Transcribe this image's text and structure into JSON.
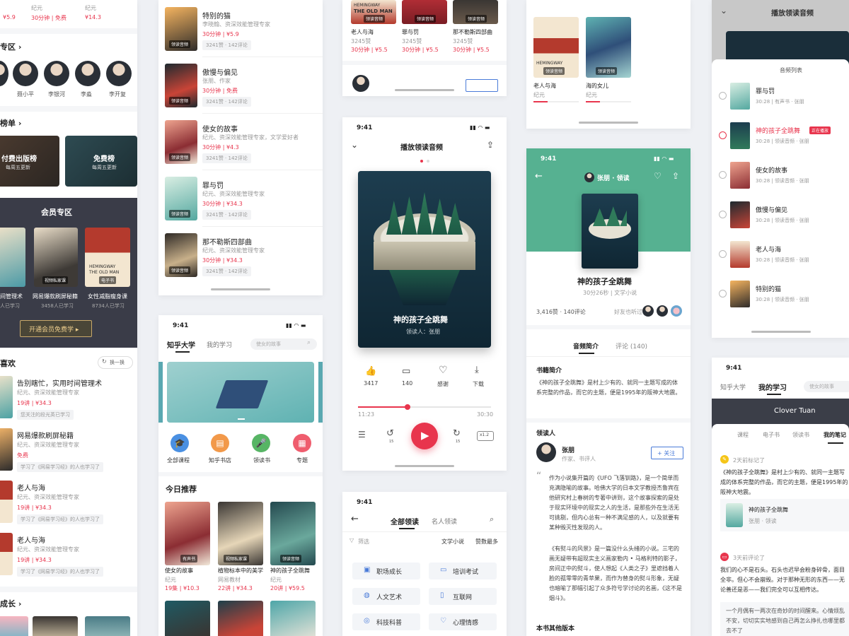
{
  "col1": {
    "top_prices": [
      "¥5.9",
      "30分钟 | 免费",
      "¥14.3"
    ],
    "top_labels": [
      "纪元",
      "30分钟 | 免费",
      "纪元"
    ],
    "expert_title": "专区",
    "experts": [
      "聂小平",
      "李银河",
      "李淼",
      "李开复"
    ],
    "rank_title": "榜单",
    "rank_cards": [
      {
        "title": "付费出版榜",
        "sub": "每周五更新"
      },
      {
        "title": "免费榜",
        "sub": "每周五更新"
      }
    ],
    "member_title": "会员专区",
    "member_books": [
      {
        "title": "间管理术",
        "count": "人已学习"
      },
      {
        "title": "网易爆款刷屏秘籍",
        "count": "3458人已学习",
        "badge": "视频私家课"
      },
      {
        "title": "女性减脂瘦身课",
        "count": "8734人已学习",
        "badge": "电子书"
      }
    ],
    "member_button": "开通会员免费学 ▸",
    "like_title": "喜欢",
    "refresh": "换一换",
    "likes": [
      {
        "title": "告别瞎忙，实用时间管理术",
        "sub": "纪元、资深效能管理专家",
        "price": "19讲 | ¥34.3",
        "tag": "您关注的段光英已学习"
      },
      {
        "title": "网易爆款刷屏秘籍",
        "sub": "纪元、资深效能管理专家",
        "price": "免费",
        "tag": "学习了《网易学习经》的人也学习了"
      },
      {
        "title": "老人与海",
        "sub": "纪元、资深效能管理专家",
        "price": "19讲 | ¥34.3",
        "tag": "学习了《网易学习经》的人也学习了"
      },
      {
        "title": "老人与海",
        "sub": "纪元、资深效能管理专家",
        "price": "19讲 | ¥34.3",
        "tag": "学习了《网易学习经》的人也学习了"
      }
    ],
    "grow_title": "成长"
  },
  "col2": {
    "list": [
      {
        "title": "特别的猫",
        "sub": "李晓翰、资深效能管理专家",
        "price": "30分钟 | ¥5.9",
        "tag": "3241赞 · 142评论",
        "badge": "领读音频"
      },
      {
        "title": "傲慢与偏见",
        "sub": "张朋、作家",
        "price": "30分钟 | 免费",
        "tag": "3241赞 · 142评论",
        "badge": "领读音频"
      },
      {
        "title": "使女的故事",
        "sub": "纪元、资深效能管理专家，文学爱好者",
        "price": "30分钟 | ¥4.3",
        "tag": "3241赞 · 142评论",
        "badge": "领读音频"
      },
      {
        "title": "罪与罚",
        "sub": "纪元、资深效能管理专家",
        "price": "30分钟 | ¥34.3",
        "tag": "3241赞 · 142评论",
        "badge": "领读音频"
      },
      {
        "title": "那不勒斯四部曲",
        "sub": "纪元、资深效能管理专家",
        "price": "30分钟 | ¥34.3",
        "tag": "3241赞 · 142评论",
        "badge": "领读音频"
      }
    ],
    "home": {
      "time": "9:41",
      "tab_active": "知乎大学",
      "tab_other": "我的学习",
      "search_placeholder": "使女的故事",
      "shortcuts": [
        "全部课程",
        "知乎书店",
        "领读书",
        "专题"
      ],
      "recommend_title": "今日推荐",
      "recs": [
        {
          "title": "使女的故事",
          "sub": "纪元",
          "price": "19集 | ¥10.3",
          "badge": "有声书"
        },
        {
          "title": "植物标本中的美学",
          "sub": "网易教材",
          "price": "22讲 | ¥34.3",
          "badge": "视频私家课"
        },
        {
          "title": "神的孩子全跳舞",
          "sub": "纪元",
          "price": "20讲 | ¥59.5",
          "badge": "领读音频"
        }
      ]
    }
  },
  "col3": {
    "top_books": [
      {
        "title": "老人与海",
        "sub": "3245赞",
        "price": "30分钟 | ¥5.5",
        "badge": "领读音频"
      },
      {
        "title": "罪与罚",
        "sub": "3245赞",
        "price": "30分钟 | ¥5.5",
        "badge": "领读音频"
      },
      {
        "title": "那不勒斯四部曲",
        "sub": "3245赞",
        "price": "30分钟 | ¥5.5",
        "badge": "领读音频"
      }
    ],
    "player": {
      "time": "9:41",
      "title": "播放领读音频",
      "book_title": "神的孩子全跳舞",
      "reader": "领读人：张朋",
      "actions": [
        {
          "count": "3417"
        },
        {
          "count": "140"
        },
        {
          "count": "感谢"
        },
        {
          "count": "下载"
        }
      ],
      "time_current": "11:23",
      "time_total": "30:30",
      "speed": "x1.2",
      "skip": "15"
    },
    "category": {
      "time": "9:41",
      "tab_active": "全部领读",
      "tab_other": "名人领读",
      "filter": "筛选",
      "sort_a": "文学小说",
      "sort_b": "赞数最多",
      "chips": [
        "职场成长",
        "培训考试",
        "人文艺术",
        "互联网",
        "科技科普",
        "心理情感"
      ]
    }
  },
  "col4": {
    "top_books": [
      {
        "title": "老人与海",
        "sub": "纪元",
        "badge": "领读音频"
      },
      {
        "title": "海的女儿",
        "sub": "纪元",
        "badge": "领读音频"
      }
    ],
    "detail": {
      "time": "9:41",
      "reader_header": "张朋 · 领读",
      "book_title": "神的孩子全跳舞",
      "meta": "30分26秒 | 文学小说",
      "stats": "3,416赞 · 140评论",
      "friends": "好友也听过",
      "tab_active": "音频简介",
      "tab_other": "评论 (140)",
      "intro_title": "书籍简介",
      "intro_text": "《神的孩子全跳舞》是村上少有的、就同一主题写成的体系完整的作品，而它的主题，便是1995年的阪神大地震。",
      "reader_title": "领读人",
      "reader_name": "张朋",
      "reader_role": "作家、书评人",
      "follow": "+ 关注",
      "quote_1": "作为小说集开篇的《UFO 飞落钏路》，是一个简单而充满隐喻的故事。哈佛大学的日本文学教授杰鲁宾在他研究村上春树的专著中讲到，这个故事探索的是处于现实环境中的现实之人的生活，是那些外在生活无可挑剔，但内心总有一种不满足感的人，以及就要有某种毁灭性发现的人。",
      "quote_2": "《有熨斗的风景》是一篇没什么头绪的小说。三宅的画无疑带有超现实主义画家勒内 • 马格利特的影子，房间正中的熨斗，使人想起《人类之子》里遮挡着人脸的孤零零的青苹果，而作为替身的熨斗形象，无疑也暗喻了那幅引起了众多符号学讨论的名画，《这不是烟斗》。",
      "more_title": "本书其他版本"
    }
  },
  "col5": {
    "header_title": "播放领读音频",
    "playlist_title": "音频列表",
    "playing_badge": "正在播放",
    "items": [
      {
        "title": "罪与罚",
        "sub": "30:28 | 有声书 · 张朋"
      },
      {
        "title": "神的孩子全跳舞",
        "sub": "30:28 | 领读音频 · 张朋"
      },
      {
        "title": "使女的故事",
        "sub": "30:28 | 领读音频 · 张朋"
      },
      {
        "title": "傲慢与偏见",
        "sub": "30:28 | 领读音频 · 张朋"
      },
      {
        "title": "老人与海",
        "sub": "30:28 | 领读音频 · 张朋"
      },
      {
        "title": "特别的猫",
        "sub": "30:28 | 领读音频 · 张朋"
      }
    ],
    "notes": {
      "time": "9:41",
      "tab_other": "知乎大学",
      "tab_active": "我的学习",
      "search_placeholder": "使女的故事",
      "user": "Clover Tuan",
      "subtabs": [
        "课程",
        "电子书",
        "领读书",
        "我的笔记"
      ],
      "note1_time": "2天前标记了",
      "note1_text": "《神的孩子全跳舞》是村上少有的、就同一主题写成的体系完整的作品，而它的主题，便是1995年的阪神大地震。",
      "note1_book": "神的孩子全跳舞",
      "note1_author": "张朋 · 领读",
      "note2_time": "3天前评论了",
      "note2_text": "我们的心不是石头。石头也迟早会粉身碎骨，面目全非。但心不会崩毁。对于那种无形的东西——无论善还是恶——我们完全可以互相传达。",
      "note2_more": "一个月偶有一两次在奇妙的时间醒来。心情烦乱不安，切切实实地感到自己再怎么挣扎也哪里都去不了"
    }
  }
}
